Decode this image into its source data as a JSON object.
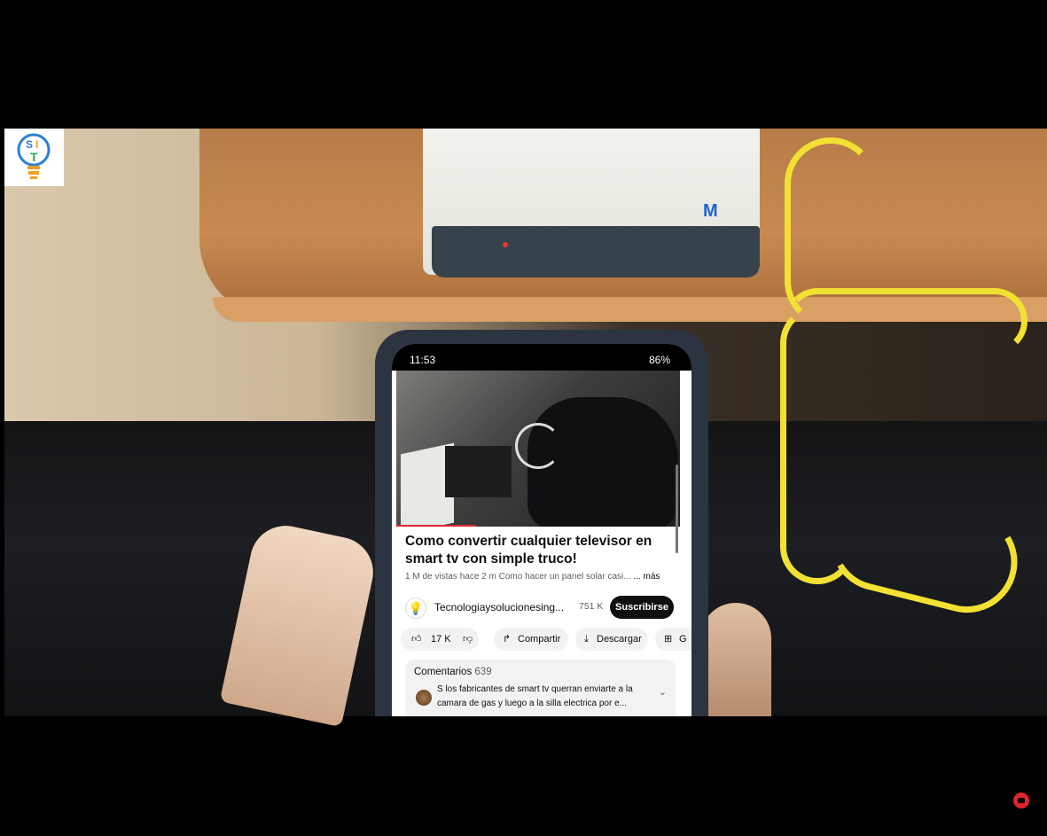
{
  "phone": {
    "status": {
      "time": "11:53",
      "battery": "86%"
    },
    "video": {
      "title": "Como convertir cualquier televisor en smart tv con simple truco!",
      "views": "1 M de vistas",
      "age": "hace 2 m",
      "hashtag_text": "Como hacer un panel solar casi...",
      "more": "... más"
    },
    "channel": {
      "name": "Tecnologiaysolucionesing...",
      "subscribers": "751 K",
      "subscribe_label": "Suscribirse"
    },
    "actions": {
      "likes": "17 K",
      "share": "Compartir",
      "download": "Descargar",
      "save_partial": "G"
    },
    "comments": {
      "label": "Comentarios",
      "count": "639",
      "top_comment": "S los fabricantes de smart tv querran enviarte a la camara de gas y luego a la silla electrica por e..."
    }
  },
  "overlay": {
    "logo_text": "SIT",
    "router_logo": "M"
  },
  "colors": {
    "accent_red": "#e0242b",
    "cable_yellow": "#f2e132"
  }
}
